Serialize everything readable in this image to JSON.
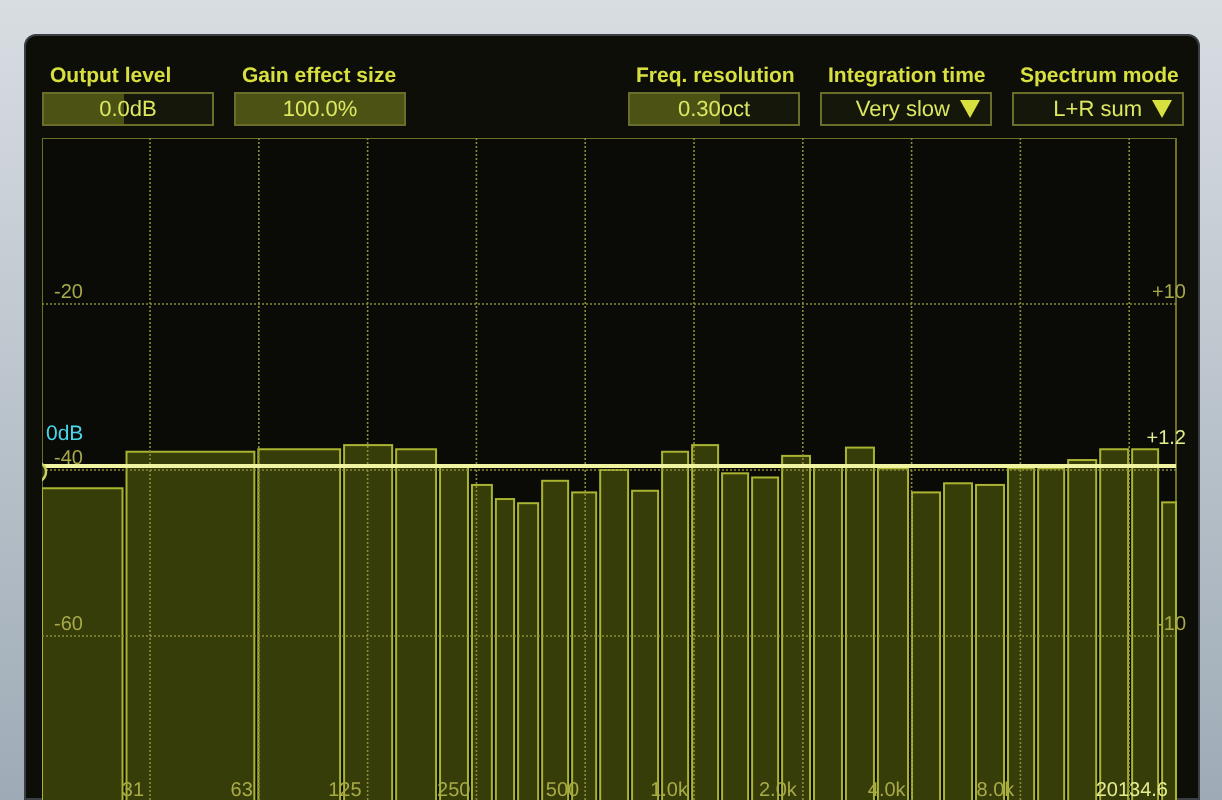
{
  "left_controls": [
    {
      "kind": "slider",
      "label": "Output level",
      "value": "0.0dB",
      "level": 0.48
    },
    {
      "kind": "slider",
      "label": "Gain effect size",
      "value": "100.0%",
      "level": 1
    }
  ],
  "right_controls": [
    {
      "kind": "slider",
      "label": "Freq. resolution",
      "value": "0.30oct",
      "level": 0.53
    },
    {
      "kind": "dropdown",
      "label": "Integration time",
      "value": "Very slow"
    },
    {
      "kind": "dropdown",
      "label": "Spectrum mode",
      "value": "L+R sum"
    }
  ],
  "spectrum": {
    "left_axis_labels": [
      "-20",
      "-40",
      "-60"
    ],
    "right_axis_labels": [
      "+10",
      "-10"
    ],
    "frequency_labels": [
      "31",
      "63",
      "125",
      "250",
      "500",
      "1.0k",
      "2.0k",
      "4.0k",
      "8.0k"
    ],
    "gain_line": {
      "left_label": "0dB",
      "right_label": "+1.2"
    },
    "cursor_frequency": "20134.6"
  }
}
